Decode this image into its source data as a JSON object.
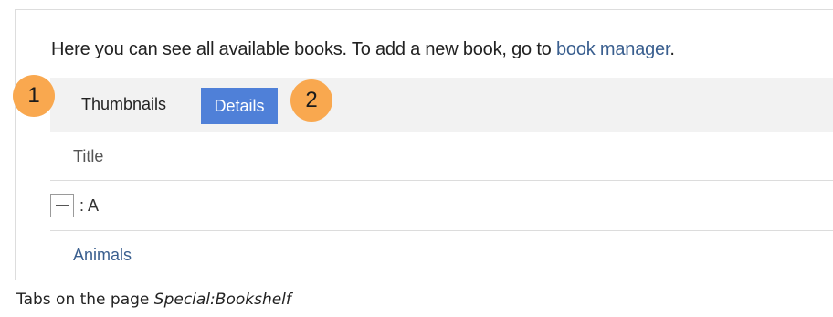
{
  "intro": {
    "text": "Here you can see all available books. To add a new book, go to ",
    "link": "book manager",
    "end": "."
  },
  "tabs": [
    {
      "label": "Thumbnails",
      "active": false
    },
    {
      "label": "Details",
      "active": true
    }
  ],
  "badges": [
    "1",
    "2"
  ],
  "table": {
    "header": "Title",
    "group": {
      "label": ": A"
    },
    "rows": [
      {
        "title": "Animals"
      }
    ]
  },
  "caption": {
    "prefix": "Tabs on the page ",
    "page": "Special:Bookshelf"
  },
  "colors": {
    "accent": "#4f80d8",
    "badge": "#f9a84f",
    "link": "#3a5f8f"
  }
}
